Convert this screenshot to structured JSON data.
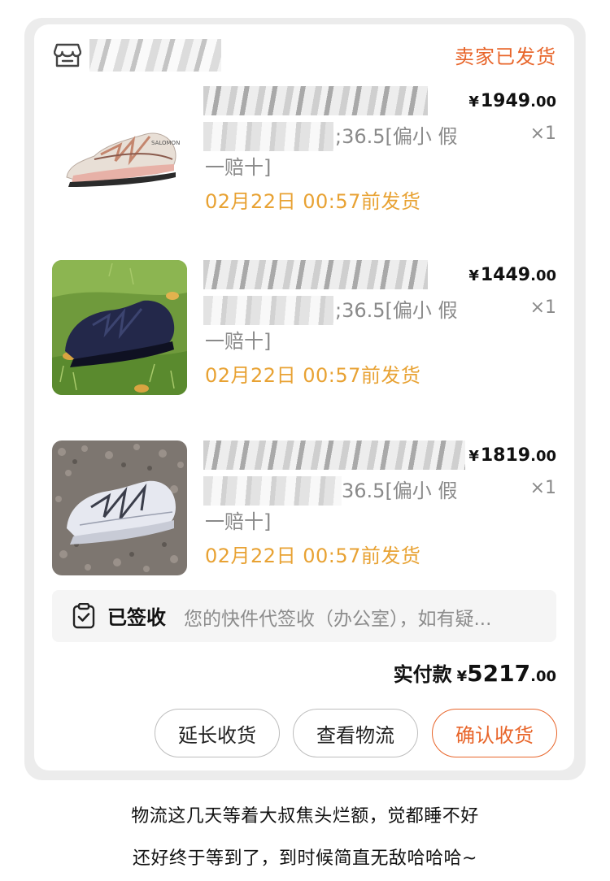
{
  "order": {
    "status": "卖家已发货",
    "items": [
      {
        "price_yen": "¥",
        "price_int": "1949",
        "price_dec": ".00",
        "qty": "×1",
        "sku_tail": ";36.5[偏小 假",
        "sku_line2": "一赔十]",
        "ship_time": "02月22日 00:57前发货"
      },
      {
        "price_yen": "¥",
        "price_int": "1449",
        "price_dec": ".00",
        "qty": "×1",
        "sku_tail": ";36.5[偏小 假",
        "sku_line2": "一赔十]",
        "ship_time": "02月22日 00:57前发货"
      },
      {
        "price_yen": "¥",
        "price_int": "1819",
        "price_dec": ".00",
        "qty": "×1",
        "sku_tail": "36.5[偏小 假",
        "sku_line2": "一赔十]",
        "ship_time": "02月22日 00:57前发货"
      }
    ],
    "delivery": {
      "status": "已签收",
      "detail": "您的快件代签收（办公室），如有疑..."
    },
    "total": {
      "label": "实付款",
      "yen": "¥",
      "int": "5217",
      "dec": ".00"
    },
    "buttons": {
      "extend": "延长收货",
      "logistics": "查看物流",
      "confirm": "确认收货"
    }
  },
  "caption": {
    "line1": "物流这几天等着大叔焦头烂额，觉都睡不好",
    "line2": "还好终于等到了，到时候简直无敌哈哈哈~"
  },
  "icons": {
    "shop": "shop-icon",
    "signed": "clipboard-check-icon"
  },
  "colors": {
    "accent": "#e8652a",
    "ship_time": "#e8a233",
    "muted": "#8a8a8a"
  }
}
